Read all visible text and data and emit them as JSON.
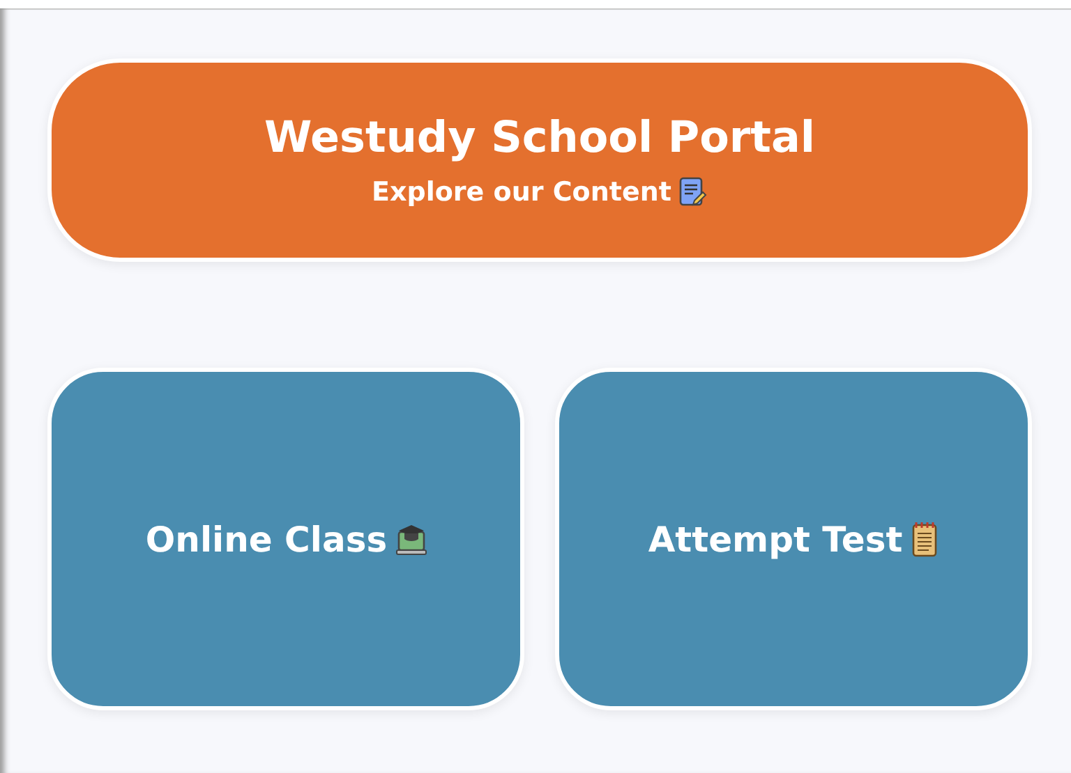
{
  "header": {
    "title": "Westudy School Portal",
    "subtitle": "Explore our Content"
  },
  "cards": [
    {
      "label": "Online Class"
    },
    {
      "label": "Attempt Test"
    }
  ]
}
